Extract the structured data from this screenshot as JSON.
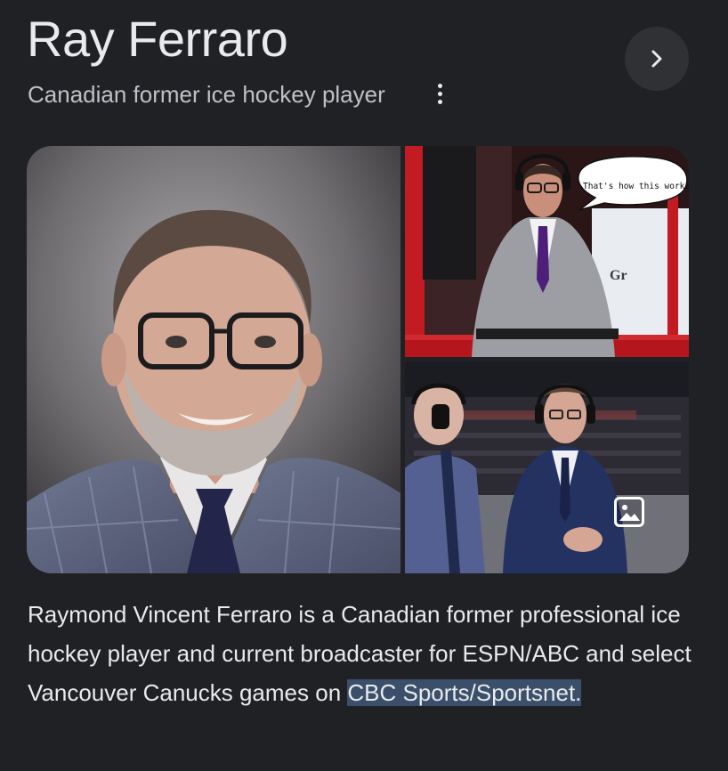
{
  "entity": {
    "name": "Ray Ferraro",
    "subtitle": "Canadian former ice hockey player"
  },
  "gallery": {
    "speech_bubble": "That's how this works",
    "sign_text": "Gr"
  },
  "description": {
    "plain": "Raymond Vincent Ferraro is a Canadian former professional ice hockey player and current broadcaster for ESPN/ABC and select Vancouver Canucks games on ",
    "highlighted": "CBC Sports/Sportsnet."
  },
  "icons": {
    "next": "chevron-right-icon",
    "more": "more-vert-icon",
    "images": "image-icon"
  },
  "colors": {
    "background": "#202124",
    "highlight": "#3c4f6a"
  }
}
